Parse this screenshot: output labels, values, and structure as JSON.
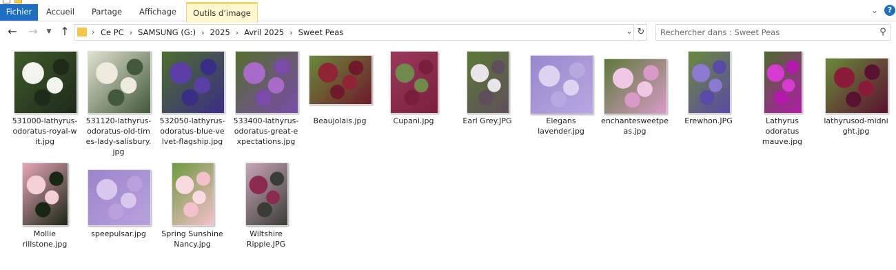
{
  "ribbon": {
    "tabs": [
      "Fichier",
      "Accueil",
      "Partage",
      "Affichage",
      "Outils d’image"
    ],
    "collapse_icon": "chevron-down-icon",
    "help_label": "?"
  },
  "address": {
    "root_icon": "folder-icon",
    "crumbs": [
      "Ce PC",
      "SAMSUNG (G:)",
      "2025",
      "Avril 2025",
      "Sweet Peas"
    ]
  },
  "search": {
    "placeholder": "Rechercher dans : Sweet Peas"
  },
  "files": [
    {
      "name": "531000-lathyrus-odoratus-royal-wit.jpg",
      "lines": [
        "531000-lathyrus-",
        "odoratus-royal-w",
        "it.jpg"
      ],
      "colors": [
        "#1e2a1a",
        "#f4f4ee",
        "#3e5a2a"
      ]
    },
    {
      "name": "531120-lathyrus-odoratus-old-times-lady-salisbury.jpg",
      "lines": [
        "531120-lathyrus-",
        "odoratus-old-tim",
        "es-lady-salisbury.",
        "jpg"
      ],
      "colors": [
        "#42593a",
        "#eeeadc",
        "#dfe2cf"
      ]
    },
    {
      "name": "532050-lathyrus-odoratus-blue-velvet-flagship.jpg",
      "lines": [
        "532050-lathyrus-",
        "odoratus-blue-ve",
        "lvet-flagship.jpg"
      ],
      "colors": [
        "#3a2d86",
        "#5b3fa6",
        "#4d6e2c"
      ]
    },
    {
      "name": "533400-lathyrus-odoratus-great-expectations.jpg",
      "lines": [
        "533400-lathyrus-",
        "odoratus-great-e",
        "xpectations.jpg"
      ],
      "colors": [
        "#7a4aa8",
        "#a96bc8",
        "#53702e"
      ]
    },
    {
      "name": "Beaujolais.jpg",
      "lines": [
        "Beaujolais.jpg"
      ],
      "colors": [
        "#6e1a2a",
        "#8f2436",
        "#6a8a3a"
      ]
    },
    {
      "name": "Cupani.jpg",
      "lines": [
        "Cupani.jpg"
      ],
      "colors": [
        "#7a1d3a",
        "#6f8a4a",
        "#9a3a5e"
      ]
    },
    {
      "name": "Earl Grey.JPG",
      "lines": [
        "Earl Grey.JPG"
      ],
      "colors": [
        "#5e4e5a",
        "#e8e4e8",
        "#5c7a36"
      ]
    },
    {
      "name": "Elegans lavender.jpg",
      "lines": [
        "Elegans",
        "lavender.jpg"
      ],
      "colors": [
        "#b8a8e0",
        "#ded4f2",
        "#9b86cf"
      ]
    },
    {
      "name": "enchantesweetpeas.jpg",
      "lines": [
        "enchantesweetpe",
        "as.jpg"
      ],
      "colors": [
        "#d99ac8",
        "#f0c8e6",
        "#5d7a3a"
      ]
    },
    {
      "name": "Erewhon.JPG",
      "lines": [
        "Erewhon.JPG"
      ],
      "colors": [
        "#5a4aa6",
        "#8c7ad0",
        "#6a8a3a"
      ]
    },
    {
      "name": "Lathyrus odoratus mauve.jpg",
      "lines": [
        "Lathyrus",
        "odoratus",
        "mauve.jpg"
      ],
      "colors": [
        "#b11aa8",
        "#d63ad0",
        "#4a6a2c"
      ]
    },
    {
      "name": "lathyrusod-midnight.jpg",
      "lines": [
        "lathyrusod-midni",
        "ght.jpg"
      ],
      "colors": [
        "#5a1030",
        "#8a1c3a",
        "#6a8a3a"
      ]
    },
    {
      "name": "Mollie rillstone.jpg",
      "lines": [
        "Mollie",
        "rillstone.jpg"
      ],
      "colors": [
        "#1a2614",
        "#f4cfd6",
        "#e8a6b8"
      ]
    },
    {
      "name": "speepulsar.jpg",
      "lines": [
        "speepulsar.jpg"
      ],
      "colors": [
        "#b7a2dc",
        "#d8c8ee",
        "#9c84cc"
      ]
    },
    {
      "name": "Spring Sunshine Nancy.jpg",
      "lines": [
        "Spring Sunshine",
        "Nancy.jpg"
      ],
      "colors": [
        "#f4c0cc",
        "#f8dce2",
        "#6e9a3e"
      ]
    },
    {
      "name": "Wiltshire Ripple.JPG",
      "lines": [
        "Wiltshire",
        "Ripple.JPG"
      ],
      "colors": [
        "#3a3d36",
        "#8a2a4e",
        "#c8a6b8"
      ]
    }
  ]
}
